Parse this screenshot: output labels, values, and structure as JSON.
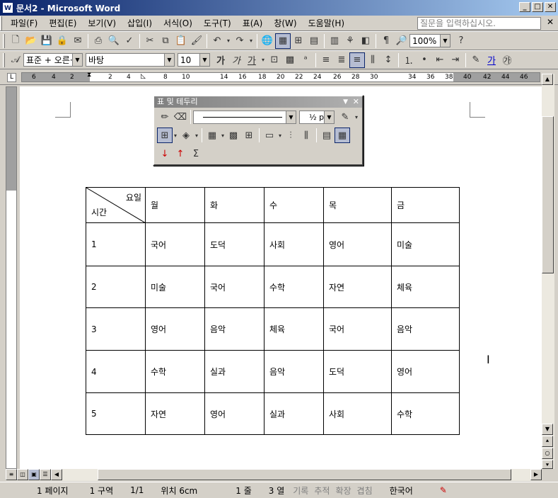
{
  "window": {
    "title": "문서2 - Microsoft Word",
    "app_icon": "word-doc-icon"
  },
  "menu": {
    "items": [
      "파일(F)",
      "편집(E)",
      "보기(V)",
      "삽입(I)",
      "서식(O)",
      "도구(T)",
      "표(A)",
      "창(W)",
      "도움말(H)"
    ],
    "ask_placeholder": "질문을 입력하십시오."
  },
  "standard_toolbar": {
    "zoom": "100%"
  },
  "format_toolbar": {
    "style": "표준 + 오른·",
    "font": "바탕",
    "size": "10"
  },
  "ruler": {
    "numbers": [
      "6",
      "4",
      "2",
      "2",
      "4",
      "8",
      "10",
      "14",
      "16",
      "18",
      "20",
      "22",
      "24",
      "26",
      "28",
      "30",
      "34",
      "36",
      "38",
      "40",
      "42",
      "44",
      "46"
    ]
  },
  "floating_toolbar": {
    "title": "표 및 테두리",
    "line_weight": "½ pt"
  },
  "timetable": {
    "header_corner_top": "요일",
    "header_corner_bottom": "시간",
    "days": [
      "월",
      "화",
      "수",
      "목",
      "금"
    ],
    "rows": [
      {
        "period": "1",
        "cells": [
          "국어",
          "도덕",
          "사회",
          "영어",
          "미술"
        ]
      },
      {
        "period": "2",
        "cells": [
          "미술",
          "국어",
          "수학",
          "자연",
          "체육"
        ]
      },
      {
        "period": "3",
        "cells": [
          "영어",
          "음악",
          "체육",
          "국어",
          "음악"
        ]
      },
      {
        "period": "4",
        "cells": [
          "수학",
          "실과",
          "음악",
          "도덕",
          "영어"
        ]
      },
      {
        "period": "5",
        "cells": [
          "자연",
          "영어",
          "실과",
          "사회",
          "수학"
        ]
      }
    ]
  },
  "status": {
    "page": "1 페이지",
    "section": "1 구역",
    "pages": "1/1",
    "position": "위치 6cm",
    "line": "1 줄",
    "col": "3 열",
    "rec": "기록",
    "trk": "추적",
    "ext": "확장",
    "ovr": "겹침",
    "language": "한국어"
  }
}
